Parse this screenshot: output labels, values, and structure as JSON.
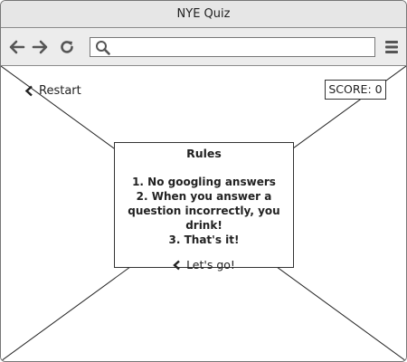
{
  "window": {
    "title": "NYE Quiz"
  },
  "browser": {
    "url_value": "",
    "icons": [
      "back-arrow-icon",
      "forward-arrow-icon",
      "reload-icon",
      "search-icon",
      "hamburger-menu-icon"
    ]
  },
  "page": {
    "restart_label": "Restart",
    "score_label": "SCORE: 0",
    "rules": {
      "title": "Rules",
      "items": [
        "1. No googling answers",
        "2. When you answer a question incorrectly, you drink!",
        "3. That's it!"
      ],
      "start_label": "Let's go!"
    }
  },
  "colors": {
    "chrome": "#e6e6e6",
    "border": "#333333",
    "icon": "#555555"
  }
}
